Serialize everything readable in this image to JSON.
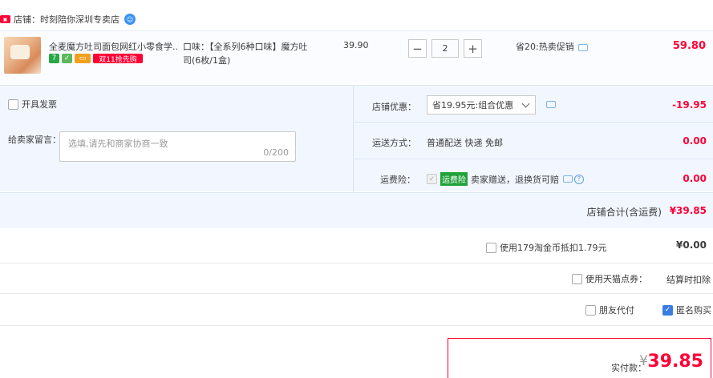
{
  "shop": {
    "icon": "tmall-shop-icon",
    "label": "店铺：时刻陪你深圳专卖店"
  },
  "item": {
    "title": "全麦魔方吐司面包网红小零食学...",
    "tags": [
      "7",
      "绿",
      "卡",
      "双11抢先购"
    ],
    "sku_line1": "口味：【全系列6种口味】魔方吐",
    "sku_line2": "司(6枚/1盒)",
    "price": "39.90",
    "quantity": "2",
    "qty_minus": "−",
    "qty_plus": "+",
    "saving": "省20:热卖促销",
    "subtotal": "59.80"
  },
  "invoice": {
    "label": "开具发票",
    "checked": false
  },
  "memo": {
    "label": "给卖家留言：",
    "placeholder": "选填,请先和商家协商一致",
    "count": "0/200"
  },
  "discount": {
    "label": "店铺优惠：",
    "selected": "省19.95元:组合优惠",
    "amount": "-19.95"
  },
  "shipping": {
    "label": "运送方式：",
    "value": "普通配送 快递 免邮",
    "amount": "0.00"
  },
  "insurance": {
    "label": "运费险：",
    "badge": "运费险",
    "text": "卖家赠送，退换货可赔",
    "amount": "0.00"
  },
  "shop_total": {
    "label": "店铺合计(含运费)",
    "value": "¥39.85"
  },
  "coins": {
    "label": "使用179淘金币抵扣1.79元",
    "value": "¥0.00"
  },
  "tmall_points": {
    "label": "使用天猫点券：",
    "right": "结算时扣除"
  },
  "friend_pay": {
    "label": "朋友代付"
  },
  "anonymous": {
    "label": "匿名购买",
    "checked": true
  },
  "payment": {
    "label": "实付款：",
    "symbol": "¥",
    "amount": "39.85"
  }
}
